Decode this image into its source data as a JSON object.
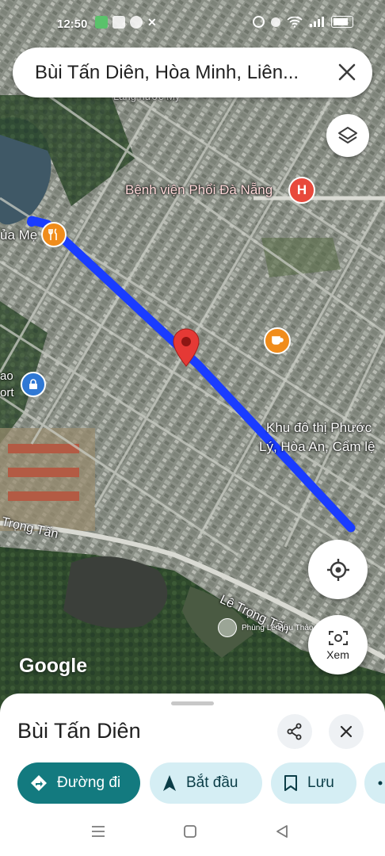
{
  "status_bar": {
    "time": "12:50"
  },
  "search": {
    "query": "Bùi Tấn Diên, Hòa Minh, Liên..."
  },
  "map": {
    "labels": {
      "hospital": "Bệnh viện Phổi Đà Nẵng",
      "restaurant_partial": "ủa Mẹ",
      "area_line1": "Khu đô thị Phước",
      "area_line2": "Lý, Hòa An, Cẩm lệ",
      "road_left": "Trọng Tấn",
      "road_bottom": "Lê Trọng Tấn",
      "left_partial_1": "ao",
      "left_partial_2": "ort",
      "top_partial": "Làng nước Mỹ"
    },
    "photo_credit": "Phùng Lê Hữu Thảo",
    "google_logo": "Google",
    "route_color": "#1a3cff",
    "marker_color": "#e53935"
  },
  "controls": {
    "streetview_label": "Xem"
  },
  "sheet": {
    "title": "Bùi Tấn Diên",
    "actions": {
      "directions": "Đường đi",
      "start": "Bắt đầu",
      "save": "Lưu"
    }
  }
}
